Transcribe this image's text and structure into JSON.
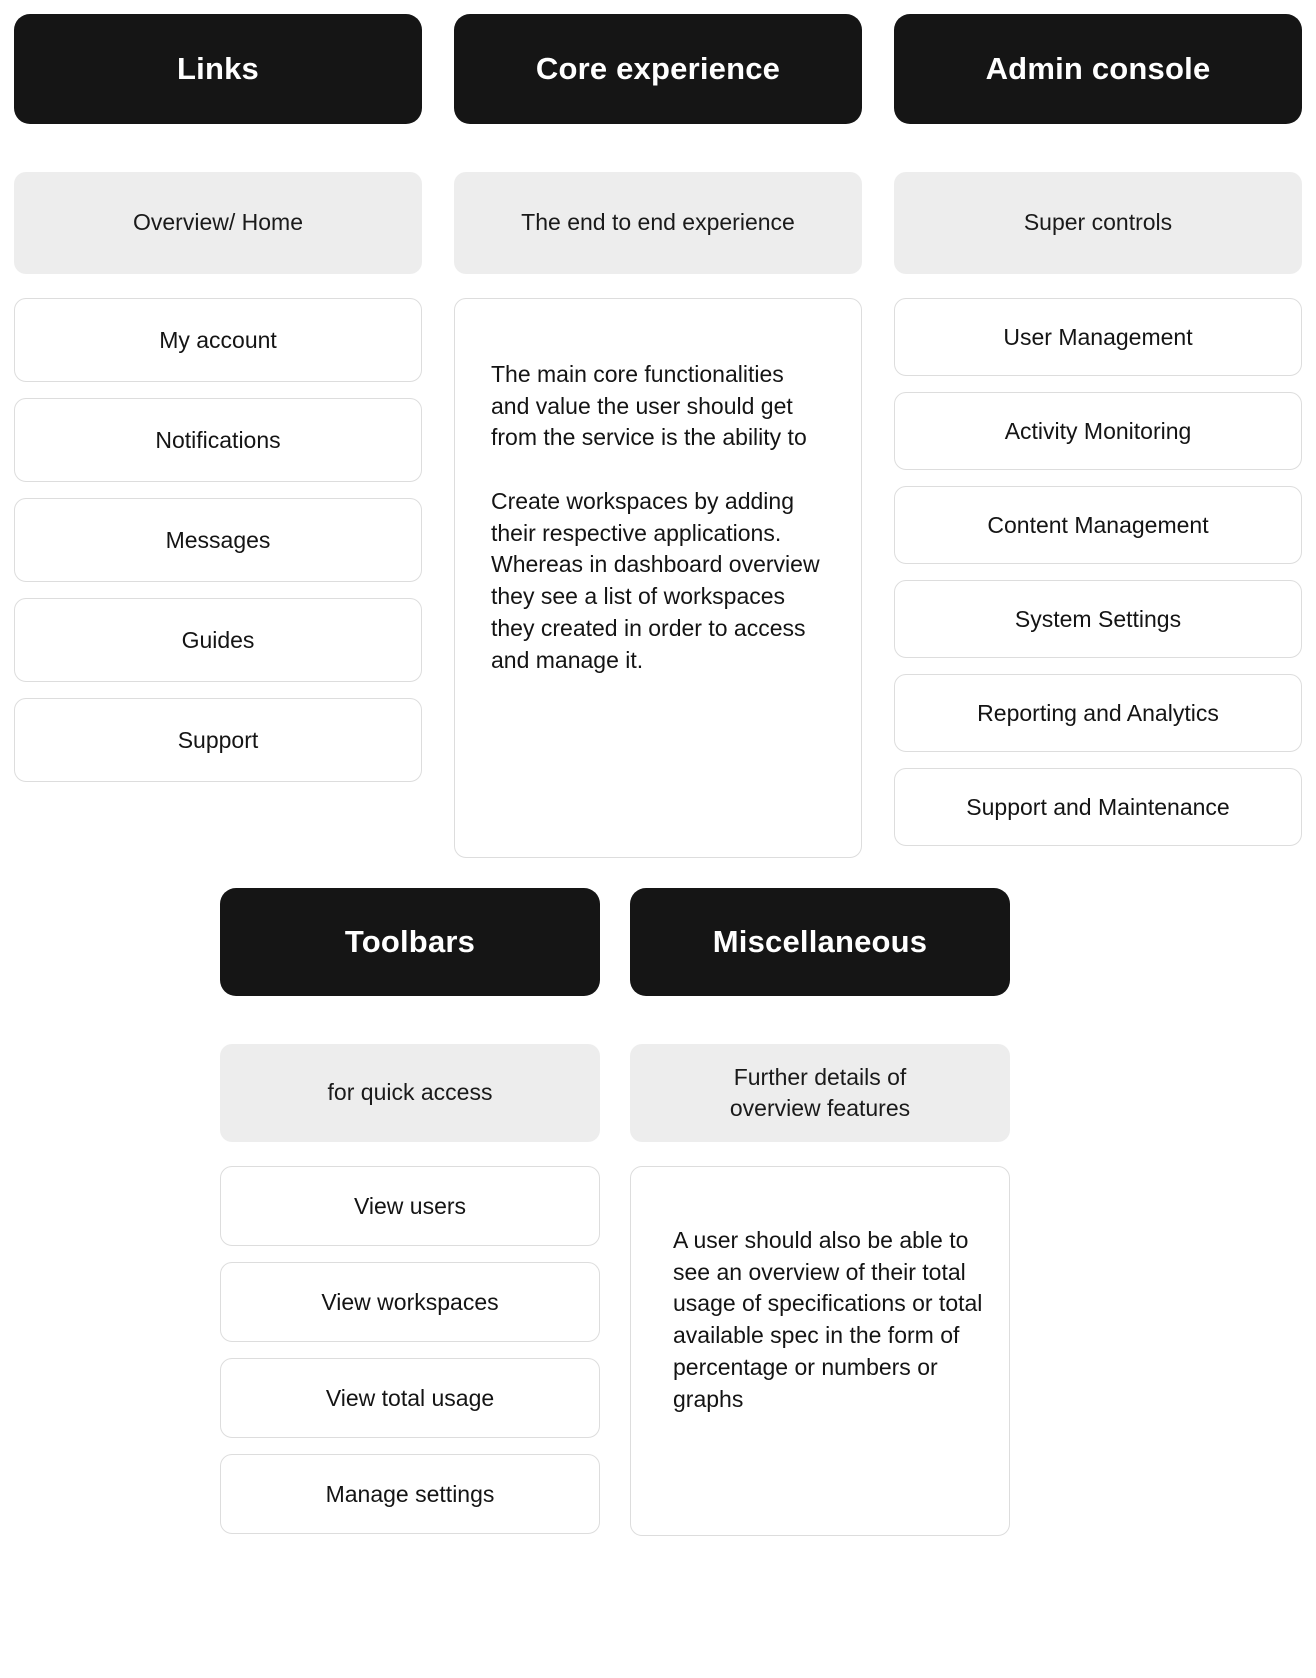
{
  "colors": {
    "header_bg": "#151515",
    "header_text": "#ffffff",
    "subheader_bg": "#ededed",
    "card_border": "#dddddd",
    "page_bg": "#ffffff",
    "text": "#141414"
  },
  "columns": [
    {
      "header": "Links",
      "subheader": "Overview/ Home",
      "items": [
        "My account",
        "Notifications",
        "Messages",
        "Guides",
        "Support"
      ]
    },
    {
      "header": "Core experience",
      "subheader": "The end to end experience",
      "note": "The main core functionalities and value the user should get from the service is the ability to\n\nCreate workspaces by adding their respective applications. Whereas in dashboard overview they see a list of workspaces they created in order to access and manage it."
    },
    {
      "header": "Admin console",
      "subheader": "Super controls",
      "items": [
        "User Management",
        "Activity Monitoring",
        "Content Management",
        "System Settings",
        "Reporting and Analytics",
        "Support and Maintenance"
      ]
    }
  ],
  "bottom_columns": [
    {
      "header": "Toolbars",
      "subheader": "for quick access",
      "items": [
        "View users",
        "View workspaces",
        "View total usage",
        "Manage settings"
      ]
    },
    {
      "header": "Miscellaneous",
      "subheader": "Further details of\noverview features",
      "note": "A user should also be able to see an overview of their total usage of specifications or total available spec in the form of percentage or numbers or graphs"
    }
  ]
}
